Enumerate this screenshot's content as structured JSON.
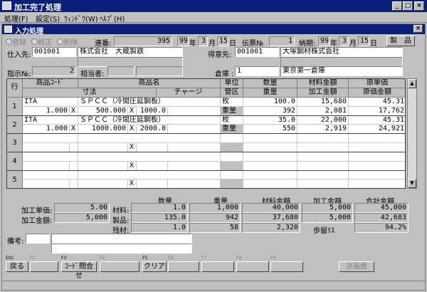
{
  "window": {
    "title": "加工完了処理"
  },
  "menu": [
    "処理(F)",
    "設定(S)",
    "ｳｨﾝﾄﾞｳ(W)",
    "ﾍﾙﾌﾟ(H)"
  ],
  "inner": {
    "title": "入力処理",
    "close": "×"
  },
  "header": {
    "radios": [
      "登録",
      "修正",
      "削除"
    ],
    "renban_label": "連番:",
    "renban": "395",
    "date1": {
      "yy": "99",
      "y": "年",
      "m": "3",
      "mu": "月",
      "d": "15",
      "du": "日"
    },
    "denpyo_label": "伝票№",
    "denpyo": "1",
    "noki_label": "納期:",
    "date2": {
      "yy": "99",
      "y": "年",
      "m": "3",
      "mu": "月",
      "d": "15",
      "du": "日"
    },
    "product_btn": "製　品",
    "shiire_label": "仕入先:",
    "shiire_code": "001001",
    "shiire_name": "株式会社　大蔵製鉄",
    "tokui_label": "得意先:",
    "tokui_code": "001001",
    "tokui_name": "大塚鋼材株式会社",
    "shiji_label": "指示№:",
    "shiji": "2",
    "aite_label": "相当者:",
    "souko_label": "倉庫 :",
    "souko_code": "1",
    "souko_name": "東京第一倉庫"
  },
  "grid": {
    "headers": {
      "gyo": "行",
      "code": "商品ｺｰﾄﾞ",
      "name": "商品名",
      "unit": "単位",
      "qty": "数量",
      "zai": "材料金額",
      "gen": "原単価",
      "sunpo": "寸法",
      "charge": "チャージ",
      "kanku": "管区",
      "weight": "重量",
      "kakou": "加工金額",
      "genka": "原価金額"
    },
    "rows": [
      {
        "no": "1",
        "code": "ITA",
        "name": "ＳＰＣＣ（冷間圧延鋼板）",
        "unit": "枚",
        "qty": "100.0",
        "zai": "15,680",
        "gen": "45.31",
        "s1": "1.000",
        "x1": "X",
        "s2": "500.000",
        "x2": "X",
        "s3": "1000.0",
        "kanku": "重量",
        "weight": "392",
        "kakou": "2,081",
        "genka": "17,762"
      },
      {
        "no": "2",
        "code": "ITA",
        "name": "ＳＰＣＣ（冷間圧延鋼板）",
        "unit": "枚",
        "qty": "35.0",
        "zai": "22,000",
        "gen": "45.31",
        "s1": "1.000",
        "x1": "X",
        "s2": "1000.000",
        "x2": "X",
        "s3": "2000.0",
        "kanku": "重量",
        "weight": "550",
        "kakou": "2,919",
        "genka": "24,921"
      },
      {
        "no": "3",
        "code": "",
        "name": "",
        "unit": "",
        "qty": "",
        "zai": "",
        "gen": "",
        "s1": "",
        "x1": "",
        "s2": "",
        "x2": "X",
        "s3": "",
        "kanku": "",
        "weight": "",
        "kakou": "",
        "genka": ""
      },
      {
        "no": "4",
        "code": "",
        "name": "",
        "unit": "",
        "qty": "",
        "zai": "",
        "gen": "",
        "s1": "",
        "x1": "",
        "s2": "",
        "x2": "X",
        "s3": "",
        "kanku": "",
        "weight": "",
        "kakou": "",
        "genka": ""
      },
      {
        "no": "5",
        "code": "",
        "name": "",
        "unit": "",
        "qty": "",
        "zai": "",
        "gen": "",
        "s1": "",
        "x1": "",
        "s2": "",
        "x2": "X",
        "s3": "",
        "kanku": "",
        "weight": "",
        "kakou": "",
        "genka": ""
      }
    ]
  },
  "summary": {
    "col_qty": "数量",
    "col_weight": "重量",
    "col_zai": "材料金額",
    "col_kakou": "加工金額",
    "col_total": "合計金額",
    "kakou_tanka_label": "加工単価:",
    "kakou_tanka": "5.00",
    "kakou_kingaku_label": "加工金額:",
    "kakou_kingaku": "5,000",
    "rows": [
      {
        "label": "材料:",
        "qty": "1.0",
        "weight": "1,000",
        "zai": "40,000",
        "kakou": "5,000",
        "total": "45,000"
      },
      {
        "label": "製品:",
        "qty": "135.0",
        "weight": "942",
        "zai": "37,680",
        "kakou": "5,000",
        "total": "42,683"
      },
      {
        "label": "残材:",
        "qty": "1.0",
        "weight": "58",
        "zai": "2,320"
      }
    ],
    "budomari_label": "歩留ﾘｽ",
    "budomari": "94.2%"
  },
  "biko_label": "備考:",
  "fkeys": [
    {
      "key": "ESC",
      "label": "戻る"
    },
    {
      "key": "F2",
      "label": ""
    },
    {
      "key": "F3",
      "label": "ｺｰﾄﾞ問合せ"
    },
    {
      "key": "F4",
      "label": ""
    },
    {
      "key": "F5",
      "label": "クリア"
    },
    {
      "key": "F6",
      "label": ""
    },
    {
      "key": "F7",
      "label": ""
    },
    {
      "key": "F8",
      "label": ""
    },
    {
      "key": "F9",
      "label": ""
    },
    {
      "key": "",
      "label": "次画面"
    }
  ]
}
